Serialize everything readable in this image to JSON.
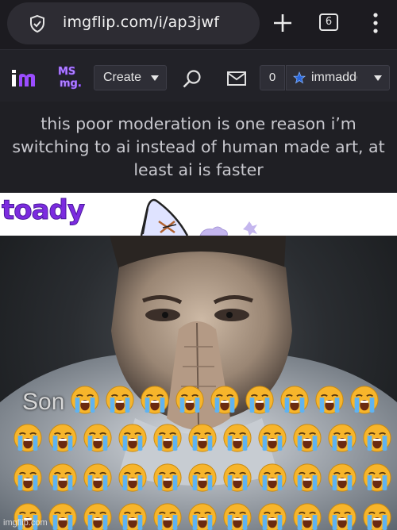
{
  "browser": {
    "url": "imgflip.com/i/ap3jwf",
    "tab_count": "6",
    "icons": [
      "shield-icon",
      "plus-icon",
      "tab-switcher-icon",
      "overflow-menu-icon"
    ]
  },
  "nav": {
    "logo_text": "im",
    "ms_logo_text": "MS\nmg.",
    "create_label": "Create",
    "notification_count": "0",
    "username": "immaddc",
    "icons": [
      "search-icon",
      "mail-icon",
      "star-icon"
    ]
  },
  "post": {
    "title": "this poor moderation is one reason i’m switching to ai instead of human made art, at least ai is faster"
  },
  "meme": {
    "top_text": "toady",
    "caption": "Son",
    "emoji_name": "loudly-crying-face",
    "watermark": "imgflip.com"
  },
  "colors": {
    "browser_bg": "#1c1b20",
    "nav_bg": "#222228",
    "logo_purple": "#9b4dff",
    "toady_purple": "#7c2be0",
    "emoji_yellow": "#f7b52b",
    "tear_blue": "#5fb3f0"
  }
}
